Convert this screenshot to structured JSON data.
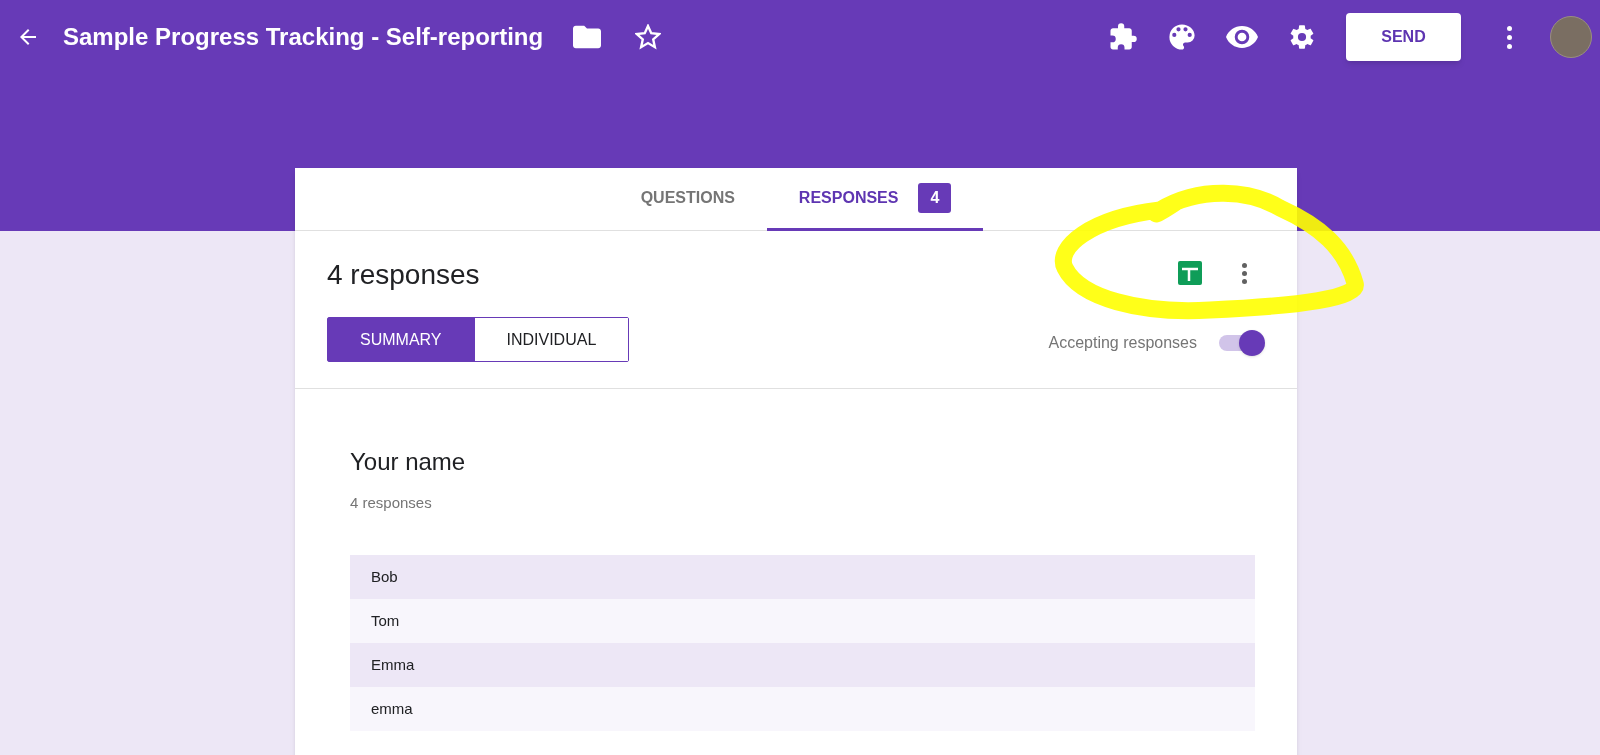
{
  "header": {
    "title": "Sample Progress Tracking - Self-reporting",
    "send_button": "SEND"
  },
  "tabs": [
    {
      "label": "QUESTIONS",
      "selected": false
    },
    {
      "label": "RESPONSES",
      "selected": true,
      "count": "4"
    }
  ],
  "responses": {
    "heading": "4 responses",
    "views": [
      {
        "label": "SUMMARY",
        "selected": true
      },
      {
        "label": "INDIVIDUAL",
        "selected": false
      }
    ],
    "accepting": {
      "label": "Accepting responses",
      "on": true
    }
  },
  "question": {
    "title": "Your name",
    "subtitle": "4 responses",
    "answers": [
      "Bob",
      "Tom",
      "Emma",
      "emma"
    ]
  }
}
